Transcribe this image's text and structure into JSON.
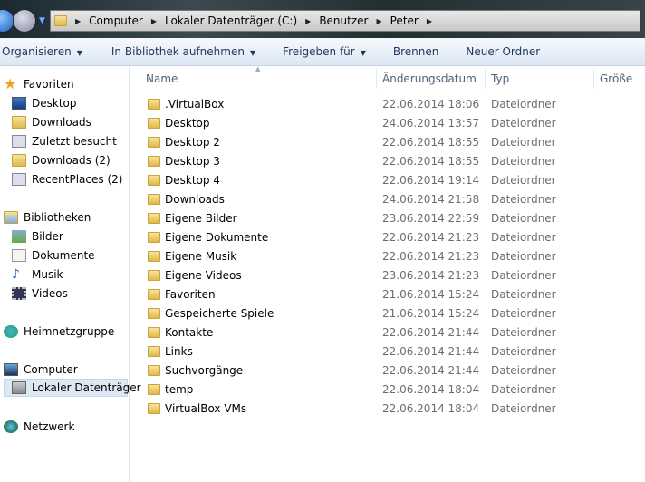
{
  "address": {
    "crumbs": [
      "Computer",
      "Lokaler Datenträger (C:)",
      "Benutzer",
      "Peter"
    ]
  },
  "toolbar": {
    "organize": "Organisieren",
    "library": "In Bibliothek aufnehmen",
    "share": "Freigeben für",
    "burn": "Brennen",
    "new_folder": "Neuer Ordner"
  },
  "nav": {
    "favorites": {
      "label": "Favoriten",
      "items": [
        "Desktop",
        "Downloads",
        "Zuletzt besucht",
        "Downloads (2)",
        "RecentPlaces (2)"
      ]
    },
    "libraries": {
      "label": "Bibliotheken",
      "items": [
        "Bilder",
        "Dokumente",
        "Musik",
        "Videos"
      ]
    },
    "homegroup": "Heimnetzgruppe",
    "computer": {
      "label": "Computer",
      "items": [
        "Lokaler Datenträger"
      ]
    },
    "network": "Netzwerk"
  },
  "columns": {
    "name": "Name",
    "date": "Änderungsdatum",
    "type": "Typ",
    "size": "Größe"
  },
  "files": [
    {
      "name": ".VirtualBox",
      "date": "22.06.2014 18:06",
      "type": "Dateiordner"
    },
    {
      "name": "Desktop",
      "date": "24.06.2014 13:57",
      "type": "Dateiordner"
    },
    {
      "name": "Desktop 2",
      "date": "22.06.2014 18:55",
      "type": "Dateiordner"
    },
    {
      "name": "Desktop 3",
      "date": "22.06.2014 18:55",
      "type": "Dateiordner"
    },
    {
      "name": "Desktop 4",
      "date": "22.06.2014 19:14",
      "type": "Dateiordner"
    },
    {
      "name": "Downloads",
      "date": "24.06.2014 21:58",
      "type": "Dateiordner"
    },
    {
      "name": "Eigene Bilder",
      "date": "23.06.2014 22:59",
      "type": "Dateiordner"
    },
    {
      "name": "Eigene Dokumente",
      "date": "22.06.2014 21:23",
      "type": "Dateiordner"
    },
    {
      "name": "Eigene Musik",
      "date": "22.06.2014 21:23",
      "type": "Dateiordner"
    },
    {
      "name": "Eigene Videos",
      "date": "23.06.2014 21:23",
      "type": "Dateiordner"
    },
    {
      "name": "Favoriten",
      "date": "21.06.2014 15:24",
      "type": "Dateiordner"
    },
    {
      "name": "Gespeicherte Spiele",
      "date": "21.06.2014 15:24",
      "type": "Dateiordner"
    },
    {
      "name": "Kontakte",
      "date": "22.06.2014 21:44",
      "type": "Dateiordner"
    },
    {
      "name": "Links",
      "date": "22.06.2014 21:44",
      "type": "Dateiordner"
    },
    {
      "name": "Suchvorgänge",
      "date": "22.06.2014 21:44",
      "type": "Dateiordner"
    },
    {
      "name": "temp",
      "date": "22.06.2014 18:04",
      "type": "Dateiordner"
    },
    {
      "name": "VirtualBox VMs",
      "date": "22.06.2014 18:04",
      "type": "Dateiordner"
    }
  ]
}
